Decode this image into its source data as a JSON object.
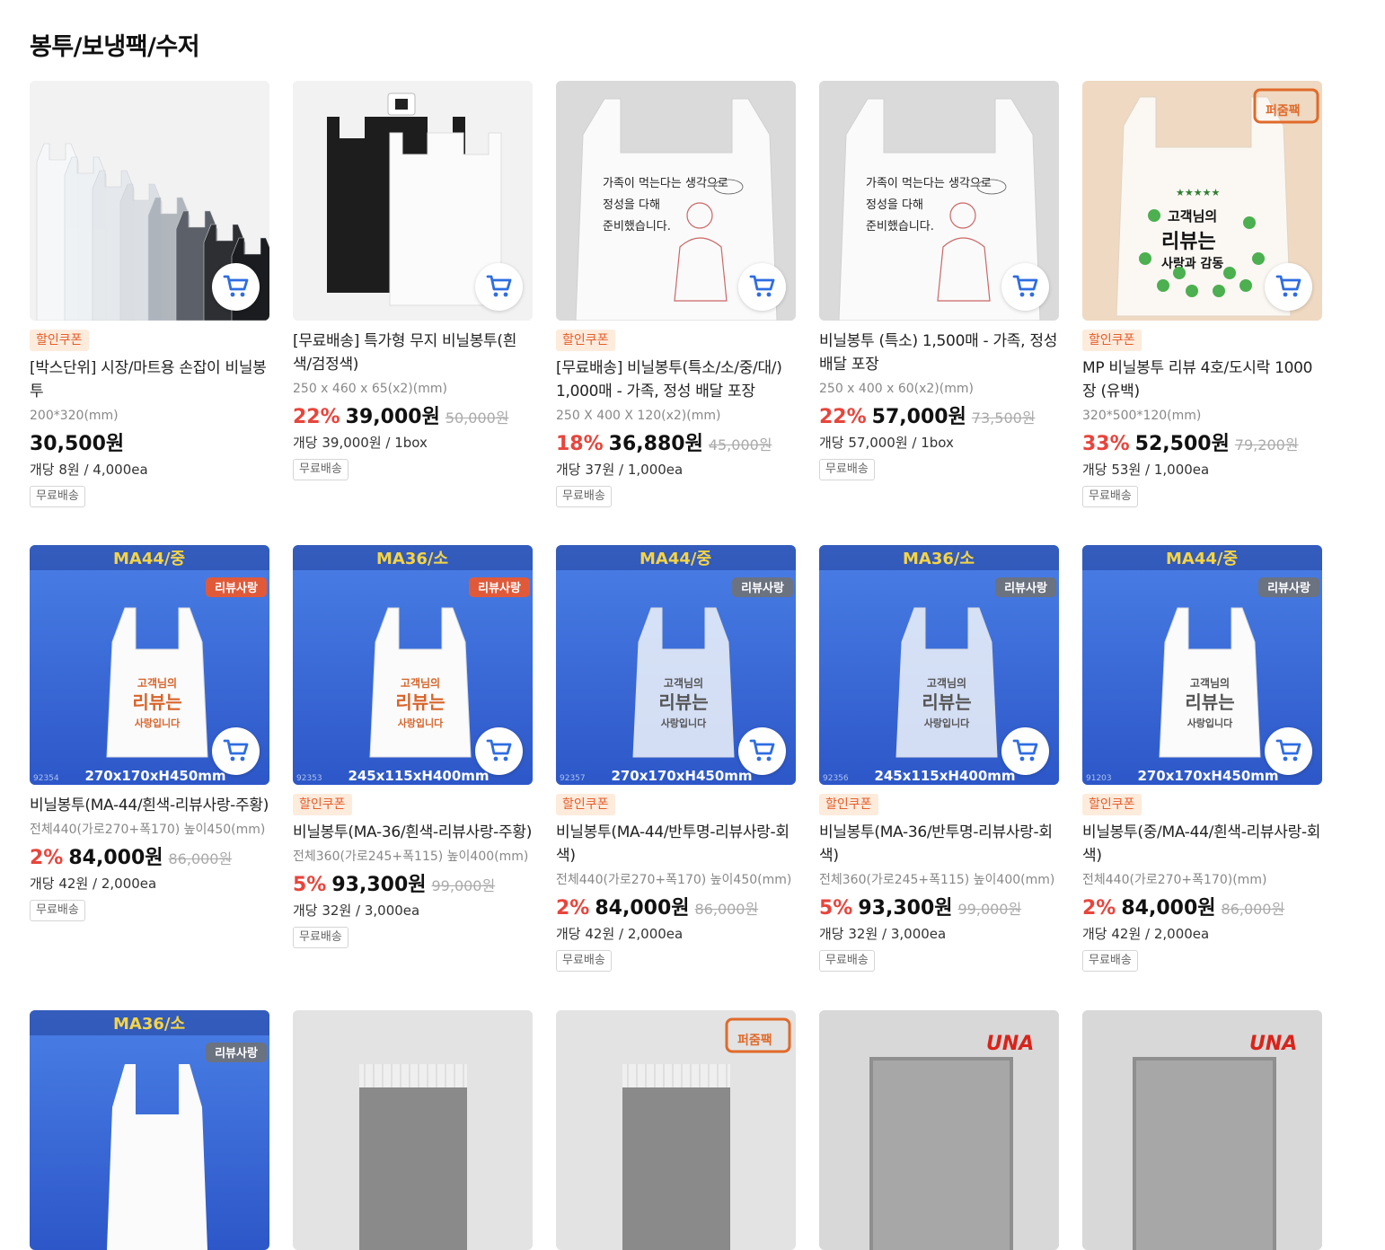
{
  "section": {
    "title": "봉투/보냉팩/수저"
  },
  "colors": {
    "accent_red": "#e8453c",
    "coupon_bg": "#fdebdc",
    "coupon_text": "#e55d2b",
    "cart_icon": "#2f6de1"
  },
  "rows": [
    [
      {
        "image": {
          "type": "bags-stack"
        },
        "coupon": "할인쿠폰",
        "name": "[박스단위] 시장/마트용 손잡이 비닐봉투",
        "spec": "200*320(mm)",
        "rate": "",
        "price": "30,500원",
        "orig": "",
        "unit": "개당 8원 / 4,000ea",
        "ship": "무료배송"
      },
      {
        "image": {
          "type": "black-white"
        },
        "coupon": "",
        "name": "[무료배송] 특가형 무지 비닐봉투(흰색/검정색)",
        "spec": "250 x 460 x 65(x2)(mm)",
        "rate": "22%",
        "price": "39,000원",
        "orig": "50,000원",
        "unit": "개당 39,000원 / 1box",
        "ship": "무료배송"
      },
      {
        "image": {
          "type": "family-bag"
        },
        "coupon": "할인쿠폰",
        "name": "[무료배송] 비닐봉투(특소/소/중/대/) 1,000매 - 가족, 정성 배달 포장",
        "spec": "250 X 400 X 120(x2)(mm)",
        "rate": "18%",
        "price": "36,880원",
        "orig": "45,000원",
        "unit": "개당 37원 / 1,000ea",
        "ship": "무료배송"
      },
      {
        "image": {
          "type": "family-bag"
        },
        "coupon": "",
        "name": "비닐봉투 (특소) 1,500매 - 가족, 정성 배달 포장",
        "spec": "250 x 400 x 60(x2)(mm)",
        "rate": "22%",
        "price": "57,000원",
        "orig": "73,500원",
        "unit": "개당 57,000원 / 1box",
        "ship": "무료배송"
      },
      {
        "image": {
          "type": "review-bag",
          "logo": "퍼줌팩"
        },
        "coupon": "할인쿠폰",
        "name": "MP 비닐봉투 리뷰 4호/도시락 1000장 (유백)",
        "spec": "320*500*120(mm)",
        "rate": "33%",
        "price": "52,500원",
        "orig": "79,200원",
        "unit": "개당 53원 / 1,000ea",
        "ship": "무료배송"
      }
    ],
    [
      {
        "image": {
          "type": "ma-bag",
          "model": "MA44/중",
          "tag": "리뷰사랑",
          "tagcolor": "#e05a3a",
          "size": "270x170xH450mm",
          "code": "92354",
          "textcolor": "#d8642a",
          "opaque": true
        },
        "coupon": "",
        "name": "비닐봉투(MA-44/흰색-리뷰사랑-주황)",
        "spec": "전체440(가로270+폭170) 높이450(mm)",
        "rate": "2%",
        "price": "84,000원",
        "orig": "86,000원",
        "unit": "개당 42원 / 2,000ea",
        "ship": "무료배송"
      },
      {
        "image": {
          "type": "ma-bag",
          "model": "MA36/소",
          "tag": "리뷰사랑",
          "tagcolor": "#e05a3a",
          "size": "245x115xH400mm",
          "code": "92353",
          "textcolor": "#d8642a",
          "opaque": true
        },
        "coupon": "할인쿠폰",
        "name": "비닐봉투(MA-36/흰색-리뷰사랑-주황)",
        "spec": "전체360(가로245+폭115) 높이400(mm)",
        "rate": "5%",
        "price": "93,300원",
        "orig": "99,000원",
        "unit": "개당 32원 / 3,000ea",
        "ship": "무료배송"
      },
      {
        "image": {
          "type": "ma-bag",
          "model": "MA44/중",
          "tag": "리뷰사랑",
          "tagcolor": "#6b7280",
          "size": "270x170xH450mm",
          "code": "92357",
          "textcolor": "#555555",
          "opaque": false
        },
        "coupon": "할인쿠폰",
        "name": "비닐봉투(MA-44/반투명-리뷰사랑-회색)",
        "spec": "전체440(가로270+폭170) 높이450(mm)",
        "rate": "2%",
        "price": "84,000원",
        "orig": "86,000원",
        "unit": "개당 42원 / 2,000ea",
        "ship": "무료배송"
      },
      {
        "image": {
          "type": "ma-bag",
          "model": "MA36/소",
          "tag": "리뷰사랑",
          "tagcolor": "#6b7280",
          "size": "245x115xH400mm",
          "code": "92356",
          "textcolor": "#555555",
          "opaque": false
        },
        "coupon": "할인쿠폰",
        "name": "비닐봉투(MA-36/반투명-리뷰사랑-회색)",
        "spec": "전체360(가로245+폭115) 높이400(mm)",
        "rate": "5%",
        "price": "93,300원",
        "orig": "99,000원",
        "unit": "개당 32원 / 3,000ea",
        "ship": "무료배송"
      },
      {
        "image": {
          "type": "ma-bag",
          "model": "MA44/중",
          "tag": "리뷰사랑",
          "tagcolor": "#6b7280",
          "size": "270x170xH450mm",
          "code": "91203",
          "textcolor": "#555555",
          "opaque": true
        },
        "coupon": "할인쿠폰",
        "name": "비닐봉투(중/MA-44/흰색-리뷰사랑-회색)",
        "spec": "전체440(가로270+폭170)(mm)",
        "rate": "2%",
        "price": "84,000원",
        "orig": "86,000원",
        "unit": "개당 42원 / 2,000ea",
        "ship": "무료배송"
      }
    ],
    [
      {
        "image": {
          "type": "ma-top",
          "model": "MA36/소",
          "tag": "리뷰사랑"
        }
      },
      {
        "image": {
          "type": "gray-pack"
        }
      },
      {
        "image": {
          "type": "gray-pack",
          "logo": "퍼줌팩"
        }
      },
      {
        "image": {
          "type": "silver-pack",
          "logo": "UNA"
        }
      },
      {
        "image": {
          "type": "silver-pack",
          "logo": "UNA"
        }
      }
    ]
  ]
}
